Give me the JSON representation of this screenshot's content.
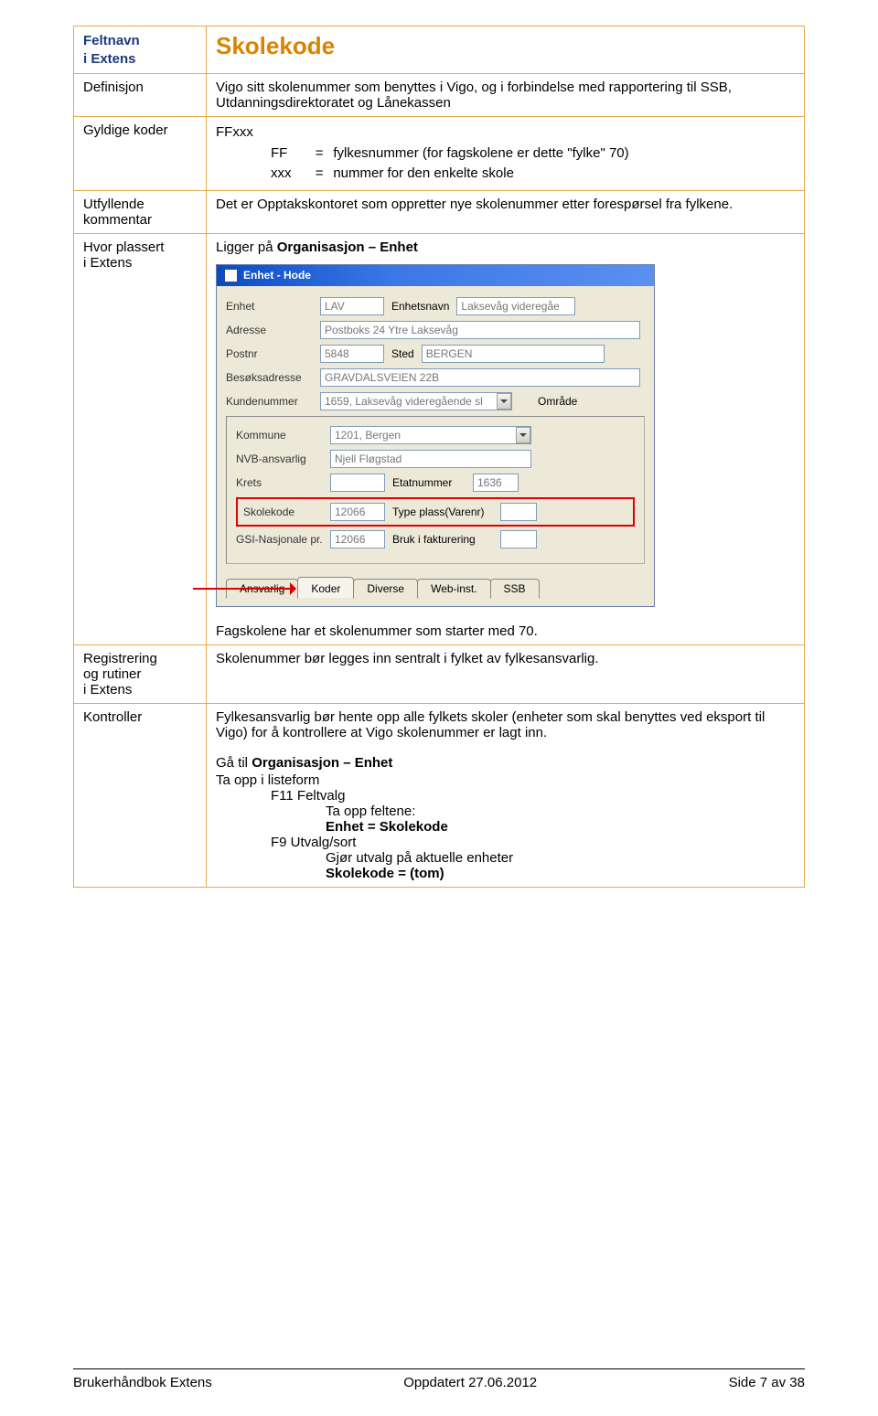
{
  "table": {
    "field_label_l1": "Feltnavn",
    "field_label_l2": "i Extens",
    "title": "Skolekode",
    "definition_label": "Definisjon",
    "definition_text": "Vigo sitt skolenummer som benyttes i Vigo, og i forbindelse med rapportering til SSB, Utdanningsdirektoratet og Lånekassen",
    "valid_label": "Gyldige koder",
    "codes": {
      "main": "FFxxx",
      "l1_abbr": "FF",
      "l1_eq": "=",
      "l1_desc": "fylkesnummer (for fagskolene er dette \"fylke\" 70)",
      "l2_abbr": "xxx",
      "l2_eq": "=",
      "l2_desc": "nummer for den enkelte skole"
    },
    "comment_label_l1": "Utfyllende",
    "comment_label_l2": "kommentar",
    "comment_text": "Det er Opptakskontoret som oppretter nye skolenummer etter forespørsel fra fylkene.",
    "placement_label_l1": "Hvor plassert",
    "placement_label_l2": "i Extens",
    "placement_prefix": "Ligger på ",
    "placement_nav": "Organisasjon – Enhet",
    "placement_note": "Fagskolene har et skolenummer som starter med 70.",
    "reg_label_l1": "Registrering",
    "reg_label_l2": "og rutiner",
    "reg_label_l3": "i Extens",
    "reg_text": "Skolenummer bør legges inn sentralt i fylket av fylkesansvarlig.",
    "ctrl_label": "Kontroller",
    "ctrl_text1": "Fylkesansvarlig bør hente opp alle fylkets skoler (enheter som skal benyttes ved eksport til Vigo) for å kontrollere at Vigo skolenummer er lagt inn.",
    "ctrl_goto_prefix": "Gå til ",
    "ctrl_goto_nav": "Organisasjon – Enhet",
    "ctrl_list": "Ta opp i listeform",
    "ctrl_f11": "F11 Feltvalg",
    "ctrl_f11_sub": "Ta opp feltene:",
    "ctrl_f11_fields": "Enhet = Skolekode",
    "ctrl_f9": "F9 Utvalg/sort",
    "ctrl_f9_sub1": "Gjør utvalg på aktuelle enheter",
    "ctrl_f9_sub2": "Skolekode = (tom)"
  },
  "win": {
    "title": "Enhet - Hode",
    "labels": {
      "enhet": "Enhet",
      "enhetsnavn": "Enhetsnavn",
      "adresse": "Adresse",
      "postnr": "Postnr",
      "sted": "Sted",
      "besok": "Besøksadresse",
      "kunde": "Kundenummer",
      "omrade": "Område",
      "kommune": "Kommune",
      "nvb": "NVB-ansvarlig",
      "krets": "Krets",
      "etat": "Etatnummer",
      "skolekode": "Skolekode",
      "typeplass": "Type plass(Varenr)",
      "gsi": "GSI-Nasjonale pr.",
      "bruk": "Bruk i fakturering"
    },
    "values": {
      "enhet": "LAV",
      "enhetsnavn": "Laksevåg videregåe",
      "adresse": "Postboks 24 Ytre Laksevåg",
      "postnr": "5848",
      "sted": "BERGEN",
      "besok": "GRAVDALSVEIEN 22B",
      "kunde": "1659, Laksevåg videregående sl",
      "kommune": "1201, Bergen",
      "nvb": "Njell Fløgstad",
      "etat": "1636",
      "skolekode": "12066",
      "gsi": "12066"
    },
    "tabs": [
      "Ansvarlig",
      "Koder",
      "Diverse",
      "Web-inst.",
      "SSB"
    ]
  },
  "footer": {
    "left": "Brukerhåndbok Extens",
    "center": "Oppdatert  27.06.2012",
    "right": "Side 7  av 38"
  }
}
